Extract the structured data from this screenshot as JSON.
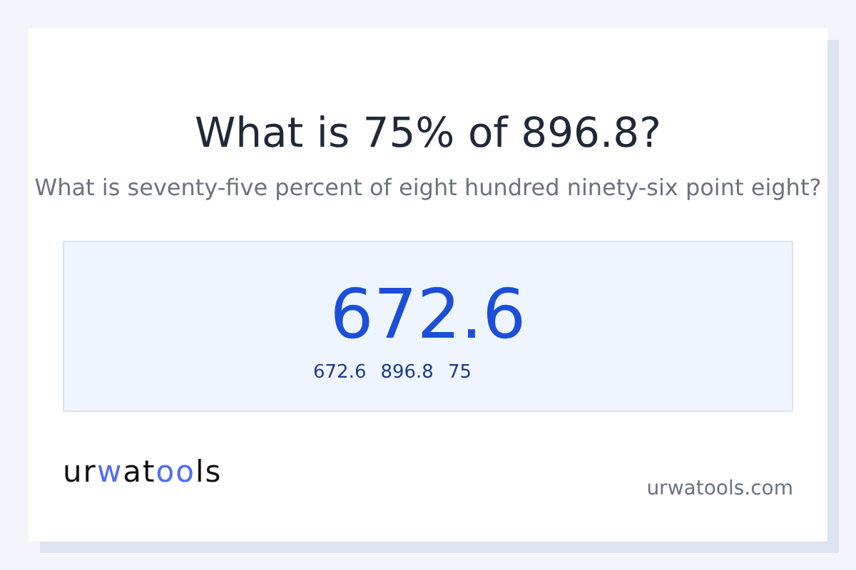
{
  "title": "What is 75% of 896.8?",
  "subtitle": "What is seventy-five percent of eight hundred ninety-six point eight?",
  "result": {
    "value": "672.6",
    "details": [
      "672.6",
      "896.8",
      "75"
    ]
  },
  "logo": [
    {
      "text": "ur",
      "accent": false
    },
    {
      "text": "w",
      "accent": true
    },
    {
      "text": "at",
      "accent": false
    },
    {
      "text": "oo",
      "accent": true
    },
    {
      "text": "ls",
      "accent": false
    }
  ],
  "domain": "urwatools.com"
}
